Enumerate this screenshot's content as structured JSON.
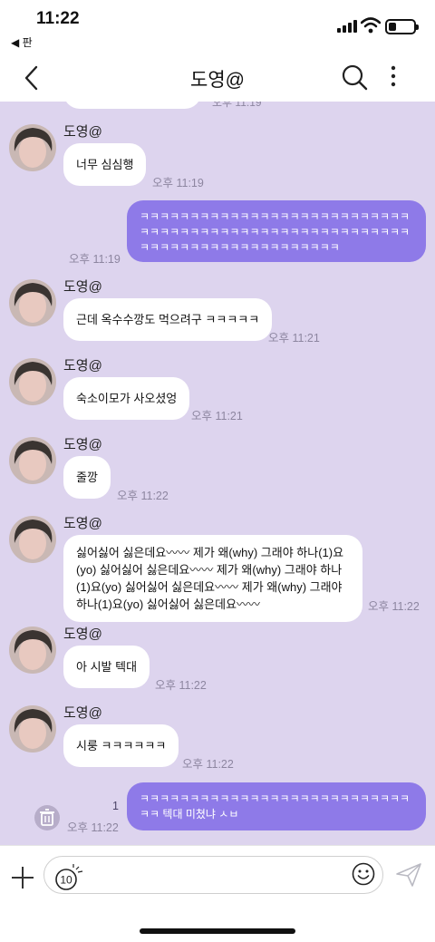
{
  "status": {
    "time": "11:22",
    "back_app": "◀ 판"
  },
  "header": {
    "title": "도영@"
  },
  "chat": {
    "prev_time": "오후 11:19",
    "messages": [
      {
        "sender": "도영@",
        "text": "너무 심심행",
        "time": "오후 11:19"
      },
      {
        "mine_text": "ㅋㅋㅋㅋㅋㅋㅋㅋㅋㅋㅋㅋㅋㅋㅋㅋㅋㅋㅋㅋㅋㅋㅋㅋㅋㅋㅋㅋㅋㅋㅋㅋㅋㅋㅋㅋㅋㅋㅋㅋㅋㅋㅋㅋㅋㅋㅋㅋㅋㅋㅋㅋㅋㅋㅋㅋㅋㅋㅋㅋㅋㅋㅋㅋㅋㅋㅋㅋㅋㅋㅋㅋㅋㅋ",
        "time": "오후 11:19"
      },
      {
        "sender": "도영@",
        "text": "근데 옥수수깡도 먹으려구 ㅋㅋㅋㅋㅋ",
        "time": "오후 11:21"
      },
      {
        "sender": "도영@",
        "text": "숙소이모가 사오셨엉",
        "time": "오후 11:21"
      },
      {
        "sender": "도영@",
        "text": "줄깡",
        "time": "오후 11:22"
      },
      {
        "sender": "도영@",
        "text": "싫어싫어 싫은데요〰〰 제가 왜(why) 그래야 하나(1)요(yo) 싫어싫어 싫은데요〰〰 제가 왜(why) 그래야 하나(1)요(yo) 싫어싫어 싫은데요〰〰 제가 왜(why) 그래야 하나(1)요(yo) 싫어싫어 싫은데요〰〰",
        "time": "오후 11:22"
      },
      {
        "sender": "도영@",
        "text": "아 시발 텍대",
        "time": "오후 11:22"
      },
      {
        "sender": "도영@",
        "text": "시룽 ㅋㅋㅋㅋㅋㅋ",
        "time": "오후 11:22"
      },
      {
        "mine_text": "ㅋㅋㅋㅋㅋㅋㅋㅋㅋㅋㅋㅋㅋㅋㅋㅋㅋㅋㅋㅋㅋㅋㅋㅋㅋㅋㅋㅋㅋ 텍대 미쳤냐 ㅅㅂ",
        "time": "오후 11:22",
        "unread": "1"
      }
    ]
  },
  "input": {
    "timer_label": "10"
  },
  "colors": {
    "chat_bg": "#ddd4ee",
    "my_bubble": "#8e7ae8",
    "their_bubble": "#ffffff"
  },
  "icons": [
    "back-chevron-icon",
    "search-icon",
    "more-vertical-icon",
    "trash-icon",
    "plus-icon",
    "timer-icon",
    "emoji-icon",
    "send-icon"
  ]
}
